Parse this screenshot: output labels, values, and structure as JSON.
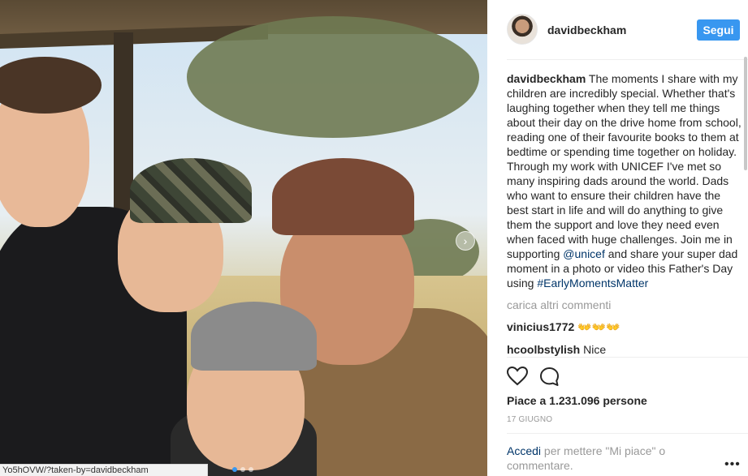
{
  "post": {
    "username": "davidbeckham",
    "follow_label": "Segui",
    "caption_text": "The moments I share with my children are incredibly special. Whether that's laughing together when they tell me things about their day on the drive home from school, reading one of their favourite books to them at bedtime or spending time together on holiday. Through my work with UNICEF I've met so many inspiring dads around the world. Dads who want to ensure their children have the best start in life and will do anything to give them the support and love they need even when faced with huge challenges. Join me in supporting",
    "caption_mention": "@unicef",
    "caption_mid": "and share your super dad moment in a photo or video this Father's Day using",
    "caption_hashtag": "#EarlyMomentsMatter",
    "load_more_label": "carica altri commenti",
    "comments": [
      {
        "user": "vinicius1772",
        "text": "👐👐👐"
      },
      {
        "user": "hcoolbstylish",
        "text": "Nice"
      }
    ],
    "likes_text": "Piace a 1.231.096 persone",
    "date_text": "17 GIUGNO",
    "login_link": "Accedi",
    "login_text": "per mettere \"Mi piace\" o commentare.",
    "more_label": "•••"
  },
  "photo": {
    "status_url": "Yo5hOVW/?taken-by=davidbeckham",
    "carousel_dots": 3,
    "active_dot": 0
  },
  "icons": {
    "heart": "heart-icon",
    "comment": "comment-bubble-icon",
    "next": "chevron-right-icon"
  },
  "colors": {
    "accent": "#3897f0",
    "link": "#003569",
    "muted": "#999999"
  }
}
